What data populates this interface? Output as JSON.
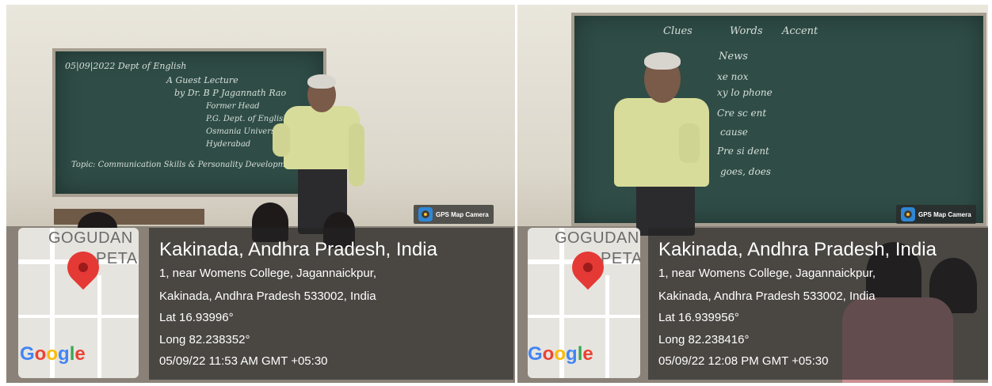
{
  "photos": [
    {
      "badge": "GPS Map Camera",
      "map_labels": [
        "GOGUDAN",
        "PETA"
      ],
      "map_logo": "Google",
      "title": "Kakinada, Andhra Pradesh, India",
      "address_line1": "1, near Womens College, Jagannaickpur,",
      "address_line2": "Kakinada, Andhra Pradesh 533002, India",
      "lat": "Lat 16.93996°",
      "long": "Long 82.238352°",
      "datetime": "05/09/22 11:53 AM GMT +05:30",
      "board_lines": [
        "05|09|2022   Dept of English",
        "A Guest Lecture",
        "by Dr. B P Jagannath Rao",
        "Former Head",
        "P.G. Dept. of English",
        "Osmania University",
        "Hyderabad",
        "Topic: Communication Skills & Personality Development"
      ]
    },
    {
      "badge": "GPS Map Camera",
      "map_labels": [
        "GOGUDAN",
        "PETA"
      ],
      "map_logo": "Google",
      "title": "Kakinada, Andhra Pradesh, India",
      "address_line1": "1, near Womens College, Jagannaickpur,",
      "address_line2": "Kakinada, Andhra Pradesh 533002, India",
      "lat": "Lat 16.939956°",
      "long": "Long 82.238416°",
      "datetime": "05/09/22 12:08 PM GMT +05:30",
      "board_lines": [
        "Clues",
        "Words",
        "Accent",
        "News",
        "xe nox",
        "xy lo phone",
        "Cre sc ent",
        "cause",
        "Pre si dent",
        "goes, does"
      ]
    }
  ],
  "icons": {
    "camera": "gps-camera-icon",
    "pin": "map-pin-icon"
  },
  "colors": {
    "overlay": "#232323",
    "pin": "#e53935",
    "board": "#2f4c46",
    "badge_icon": "#2f86d6"
  }
}
